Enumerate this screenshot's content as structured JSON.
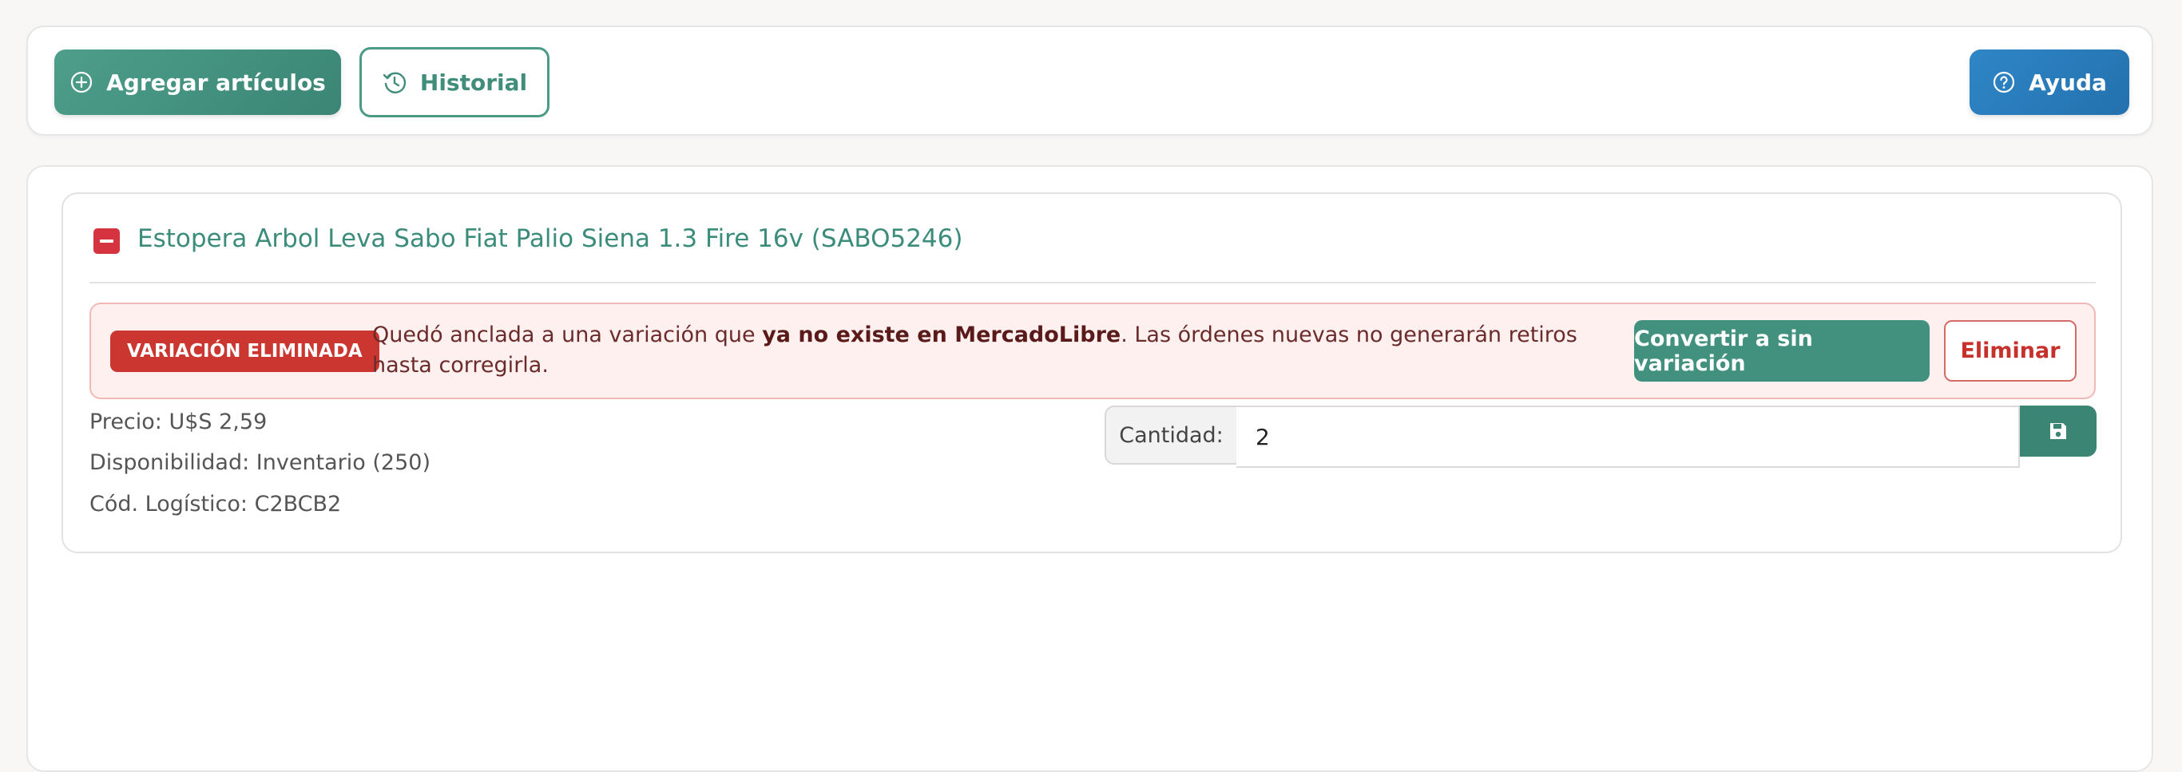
{
  "toolbar": {
    "add_label": "Agregar artículos",
    "history_label": "Historial",
    "help_label": "Ayuda"
  },
  "item": {
    "title": "Estopera Arbol Leva Sabo Fiat Palio Siena 1.3 Fire 16v (SABO5246)",
    "alert": {
      "badge": "VARIACIÓN ELIMINADA",
      "message_prefix": "Quedó anclada a una variación que ",
      "message_bold": "ya no existe en MercadoLibre",
      "message_suffix": ". Las órdenes nuevas no generarán retiros hasta corregirla.",
      "convert_label": "Convertir a sin variación",
      "delete_label": "Eliminar"
    },
    "price": "Precio: U$S 2,59",
    "availability": "Disponibilidad: Inventario (250)",
    "logistics_code": "Cód. Logístico: C2BCB2",
    "quantity_label": "Cantidad:",
    "quantity_value": "2"
  },
  "icons": {
    "add": "plus-circle-icon",
    "history": "history-icon",
    "help": "question-circle-icon",
    "collapse": "minus-square-icon",
    "save": "floppy-disk-icon"
  },
  "colors": {
    "primary_green": "#3f8d7a",
    "help_blue": "#2a7bbb",
    "danger_red": "#cc3630",
    "alert_bg": "#fdf0ef"
  }
}
